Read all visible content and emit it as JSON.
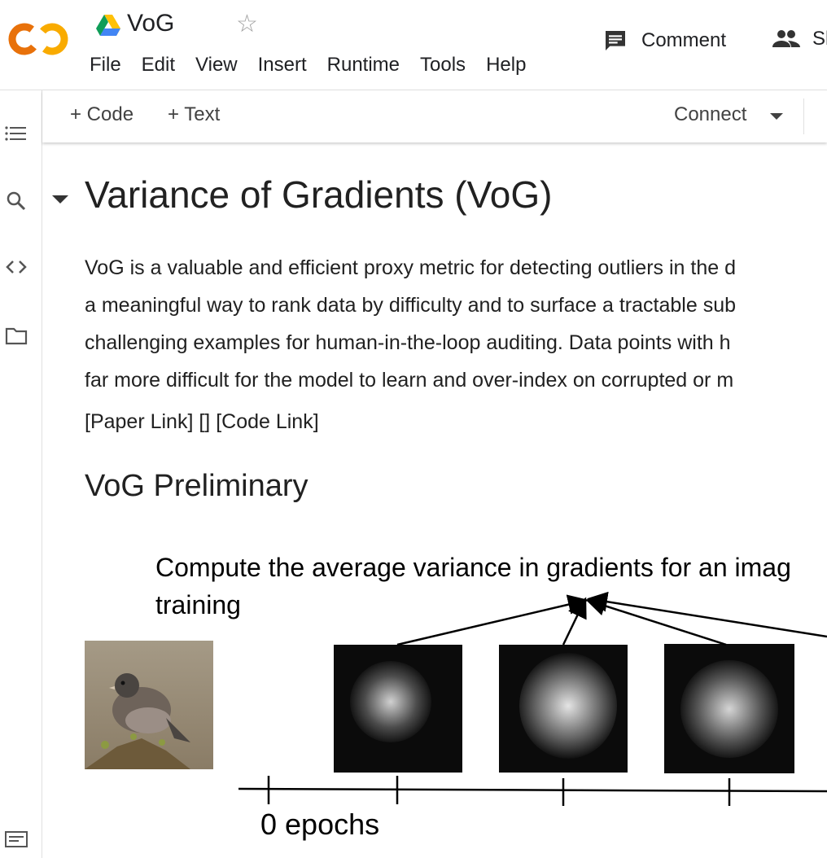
{
  "header": {
    "notebook_title": "VoG",
    "menu": [
      "File",
      "Edit",
      "View",
      "Insert",
      "Runtime",
      "Tools",
      "Help"
    ],
    "comment_label": "Comment",
    "share_label": "Sh"
  },
  "toolbar": {
    "add_code_label": "+ Code",
    "add_text_label": "+ Text",
    "connect_label": "Connect"
  },
  "content": {
    "heading": "Variance of Gradients (VoG)",
    "paragraph_lines": [
      "VoG is a valuable and efficient proxy metric for detecting outliers in the d",
      "a meaningful way to rank data by difficulty and to surface a tractable sub",
      "challenging examples for human-in-the-loop auditing. Data points with h",
      "far more difficult for the model to learn and over-index on corrupted or m"
    ],
    "links_line": "[Paper Link] [] [Code Link]",
    "subheading": "VoG Preliminary",
    "figure": {
      "title_line1": "Compute the average variance in gradients for an imag",
      "title_line2": "training",
      "axis_label": "0 epochs"
    }
  },
  "colors": {
    "logo_orange": "#F9AB00",
    "logo_dark_orange": "#E8710A",
    "text": "#212121",
    "border": "#e0e0e0"
  }
}
